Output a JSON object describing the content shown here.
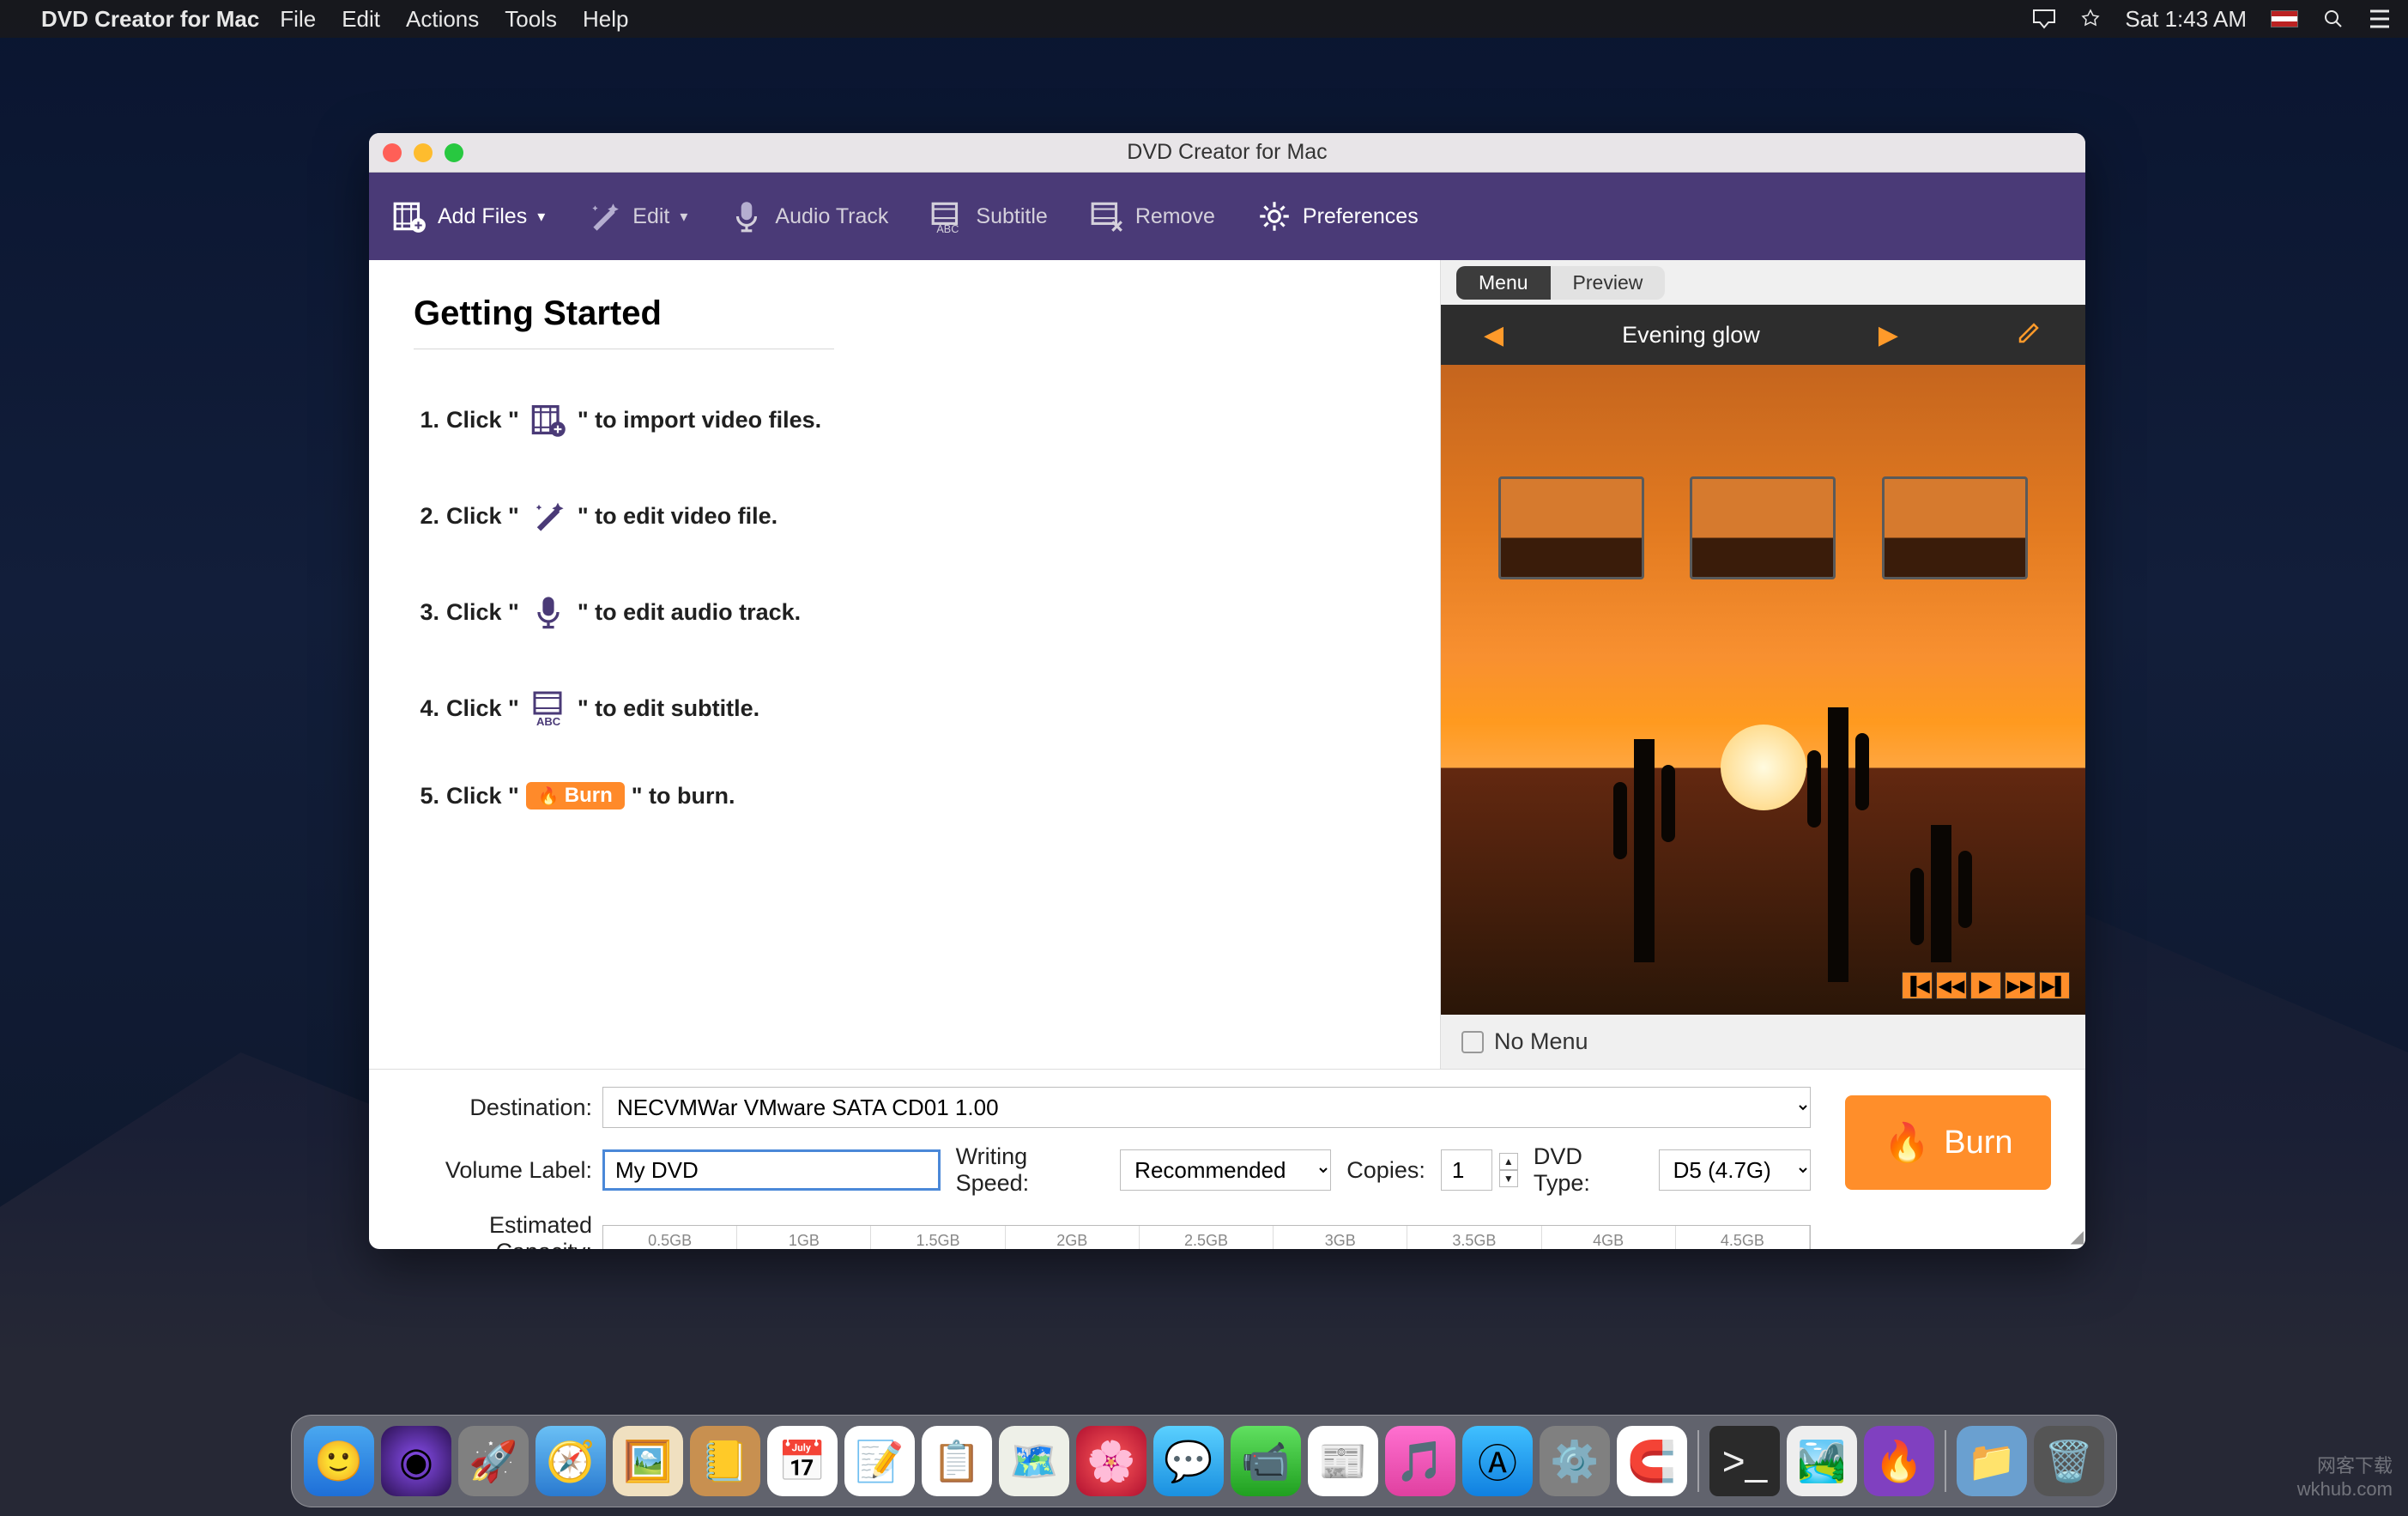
{
  "menubar": {
    "app_name": "DVD Creator for Mac",
    "items": [
      "File",
      "Edit",
      "Actions",
      "Tools",
      "Help"
    ],
    "clock": "Sat 1:43 AM"
  },
  "window": {
    "title": "DVD Creator for Mac"
  },
  "toolbar": {
    "add_files": "Add Files",
    "edit": "Edit",
    "audio_track": "Audio Track",
    "subtitle": "Subtitle",
    "remove": "Remove",
    "preferences": "Preferences"
  },
  "getting_started": {
    "heading": "Getting Started",
    "steps": {
      "s1a": "1.",
      "s1b": "Click \"",
      "s1c": "\" to import video files.",
      "s2a": "2.",
      "s2b": "Click \"",
      "s2c": "\" to edit video file.",
      "s3a": "3.",
      "s3b": "Click \"",
      "s3c": "\" to edit audio track.",
      "s4a": "4.",
      "s4b": "Click \"",
      "s4c": "\" to edit subtitle.",
      "s5a": "5.",
      "s5b": "Click \"",
      "s5pill": "Burn",
      "s5c": "\" to burn."
    }
  },
  "preview": {
    "tab_menu": "Menu",
    "tab_preview": "Preview",
    "theme_name": "Evening glow",
    "no_menu_label": "No Menu"
  },
  "bottom": {
    "destination_label": "Destination:",
    "destination_value": "NECVMWar VMware SATA CD01 1.00",
    "volume_label_label": "Volume Label:",
    "volume_label_value": "My DVD",
    "writing_speed_label": "Writing Speed:",
    "writing_speed_value": "Recommended",
    "copies_label": "Copies:",
    "copies_value": "1",
    "dvd_type_label": "DVD Type:",
    "dvd_type_value": "D5 (4.7G)",
    "capacity_label": "Estimated Capacity:",
    "capacity_ticks": [
      "0.5GB",
      "1GB",
      "1.5GB",
      "2GB",
      "2.5GB",
      "3GB",
      "3.5GB",
      "4GB",
      "4.5GB"
    ],
    "burn_label": "Burn"
  },
  "watermark": {
    "line1": "网客下载",
    "line2": "wkhub.com"
  }
}
